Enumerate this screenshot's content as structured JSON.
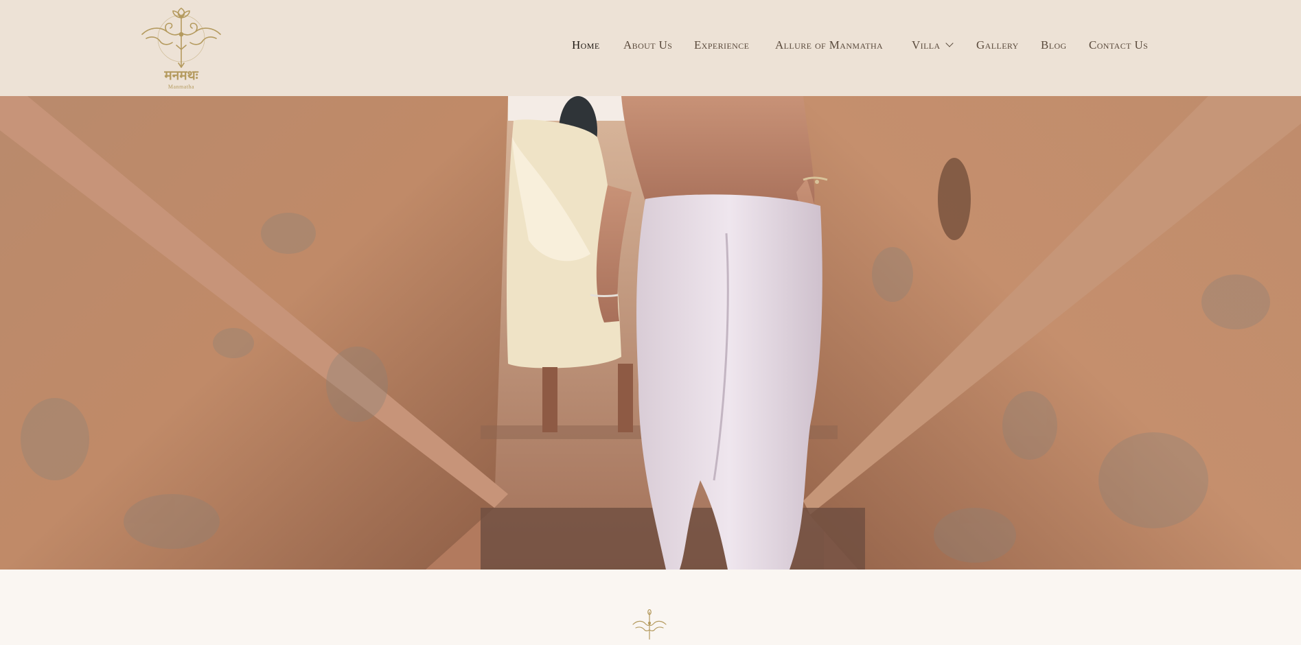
{
  "brand": {
    "name_devanagari": "मनमथः",
    "name_latin": "Manmatha",
    "logo_icon": "lotus-bow-arrow-emblem",
    "accent_color": "#b49a5e"
  },
  "nav": {
    "items": [
      {
        "label": "Home",
        "active": true
      },
      {
        "label": "About Us"
      },
      {
        "label": "Experience"
      },
      {
        "label": "Allure of Manmatha"
      },
      {
        "label": "Villa",
        "has_dropdown": true
      },
      {
        "label": "Gallery"
      },
      {
        "label": "Blog"
      },
      {
        "label": "Contact Us"
      }
    ]
  },
  "hero": {
    "image_alt": "Couple walking up a narrow stone stairway between weathered sandstone walls",
    "icon": "hero-photo"
  },
  "section": {
    "emblem_icon": "lotus-bow-arrow-emblem"
  },
  "colors": {
    "header_bg": "#ede2d6",
    "page_bg": "#faf6f2",
    "nav_text": "#5a4a3c",
    "nav_active": "#1e1812"
  }
}
